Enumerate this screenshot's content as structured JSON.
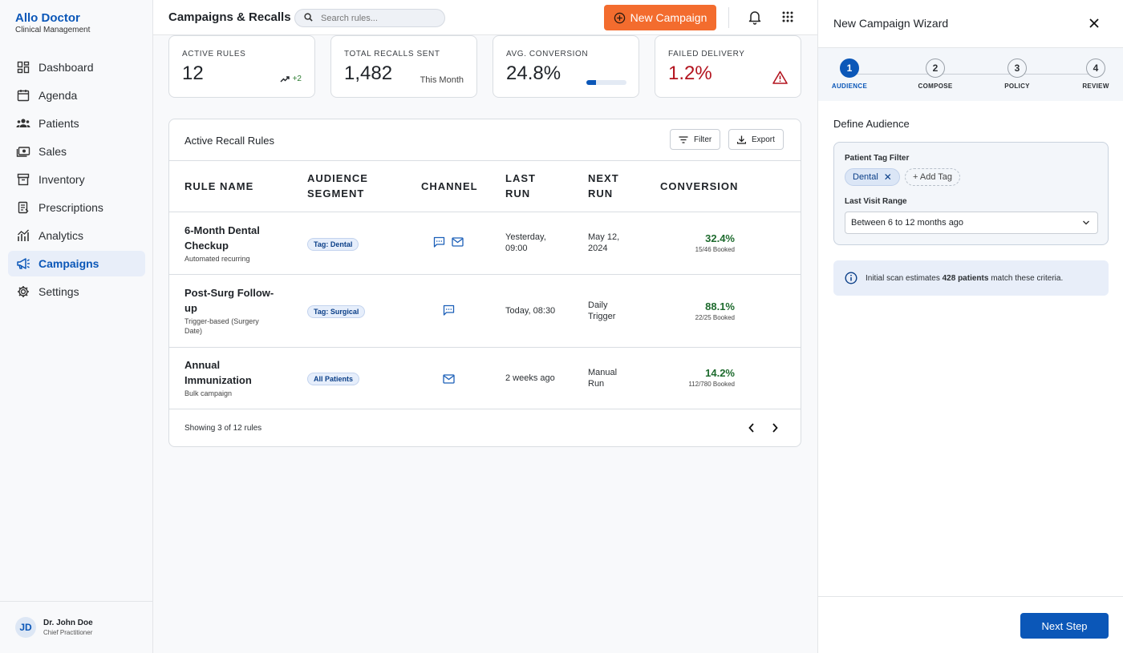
{
  "brand": {
    "name": "Allo Doctor",
    "subtitle": "Clinical Management"
  },
  "nav": [
    {
      "label": "Dashboard",
      "icon": "dashboard-icon"
    },
    {
      "label": "Agenda",
      "icon": "calendar-icon"
    },
    {
      "label": "Patients",
      "icon": "patients-icon"
    },
    {
      "label": "Sales",
      "icon": "cash-icon"
    },
    {
      "label": "Inventory",
      "icon": "archive-icon"
    },
    {
      "label": "Prescriptions",
      "icon": "prescription-icon"
    },
    {
      "label": "Analytics",
      "icon": "analytics-icon"
    },
    {
      "label": "Campaigns",
      "icon": "campaign-icon",
      "active": true
    },
    {
      "label": "Settings",
      "icon": "gear-icon"
    }
  ],
  "user": {
    "initials": "JD",
    "name": "Dr. John Doe",
    "role": "Chief Practitioner"
  },
  "header": {
    "title": "Campaigns & Recalls",
    "search_placeholder": "Search rules...",
    "new_campaign_label": "New Campaign"
  },
  "kpis": {
    "active_rules": {
      "label": "ACTIVE RULES",
      "value": "12",
      "trend": "+2"
    },
    "total_recalls": {
      "label": "TOTAL RECALLS SENT",
      "value": "1,482",
      "note": "This Month"
    },
    "avg_conversion": {
      "label": "AVG. CONVERSION",
      "value": "24.8%",
      "progress": 0.248
    },
    "failed_delivery": {
      "label": "FAILED DELIVERY",
      "value": "1.2%"
    }
  },
  "table": {
    "title": "Active Recall Rules",
    "filter_label": "Filter",
    "export_label": "Export",
    "columns": [
      "RULE NAME",
      "AUDIENCE SEGMENT",
      "CHANNEL",
      "LAST RUN",
      "NEXT RUN",
      "CONVERSION"
    ],
    "rows": [
      {
        "name": "6-Month Dental Checkup",
        "sub": "Automated recurring",
        "segment": "Tag: Dental",
        "channels": [
          "sms",
          "email"
        ],
        "last_run": "Yesterday, 09:00",
        "next_run": "May 12, 2024",
        "conversion": "32.4%",
        "booked": "15/46 Booked"
      },
      {
        "name": "Post-Surg Follow-up",
        "sub": "Trigger-based (Surgery Date)",
        "segment": "Tag: Surgical",
        "channels": [
          "sms"
        ],
        "last_run": "Today, 08:30",
        "next_run": "Daily Trigger",
        "conversion": "88.1%",
        "booked": "22/25 Booked"
      },
      {
        "name": "Annual Immunization",
        "sub": "Bulk campaign",
        "segment": "All Patients",
        "channels": [
          "email"
        ],
        "last_run": "2 weeks ago",
        "next_run": "Manual Run",
        "conversion": "14.2%",
        "booked": "112/780 Booked"
      }
    ],
    "footer": "Showing 3 of 12 rules"
  },
  "wizard": {
    "title": "New Campaign Wizard",
    "steps": [
      {
        "num": "1",
        "label": "AUDIENCE",
        "active": true
      },
      {
        "num": "2",
        "label": "COMPOSE"
      },
      {
        "num": "3",
        "label": "POLICY"
      },
      {
        "num": "4",
        "label": "REVIEW"
      }
    ],
    "section_title": "Define Audience",
    "tag_filter_label": "Patient Tag Filter",
    "tag": "Dental",
    "add_tag_label": "+ Add Tag",
    "visit_range_label": "Last Visit Range",
    "visit_range_value": "Between 6 to 12 months ago",
    "estimate_prefix": "Initial scan estimates",
    "estimate_count": "428 patients",
    "estimate_suffix": "match these criteria.",
    "next_label": "Next Step"
  },
  "colors": {
    "primary": "#0b57b8",
    "accent": "#f36c2e",
    "success": "#1e6b2e",
    "danger": "#b3141f"
  }
}
